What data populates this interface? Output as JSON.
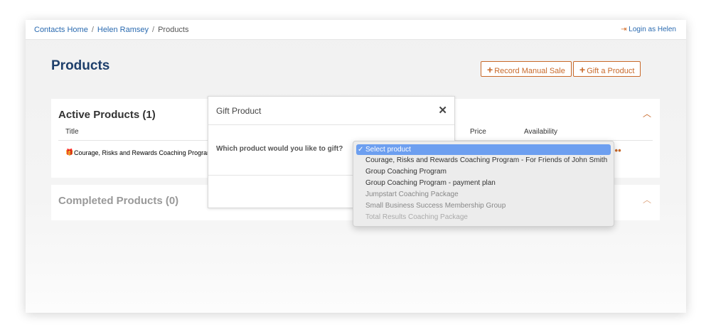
{
  "breadcrumb": [
    "Contacts Home",
    "Helen Ramsey",
    "Products"
  ],
  "login_link": "Login as Helen",
  "page_title": "Products",
  "buttons": {
    "record": "Record Manual Sale",
    "gift": "Gift a Product"
  },
  "active": {
    "title": "Active Products (1)",
    "columns": [
      "Title",
      "Price",
      "Availability"
    ],
    "rows": [
      {
        "title": "Courage, Risks and Rewards Coaching Program"
      }
    ]
  },
  "completed": {
    "title": "Completed Products (0)"
  },
  "modal": {
    "title": "Gift Product",
    "question": "Which product would you like to gift?"
  },
  "dropdown": {
    "selected": "Select product",
    "options": [
      "Courage, Risks and Rewards Coaching Program - For Friends of John Smith",
      "Group Coaching Program",
      "Group Coaching Program - payment plan",
      "Jumpstart Coaching Package",
      "Small Business Success Membership Group",
      "Total Results Coaching Package"
    ]
  }
}
